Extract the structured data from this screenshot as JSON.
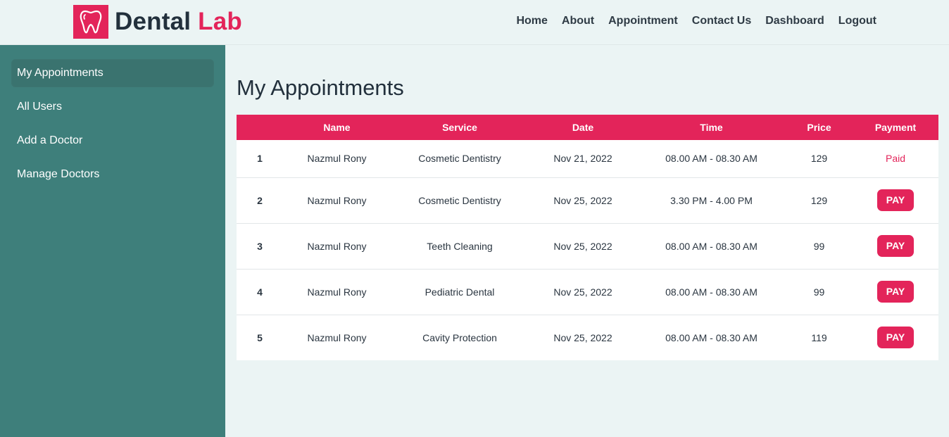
{
  "brand": {
    "word1": "Dental",
    "word2": "Lab",
    "logo_icon": "tooth-icon",
    "accent": "#e3245a"
  },
  "nav": [
    "Home",
    "About",
    "Appointment",
    "Contact Us",
    "Dashboard",
    "Logout"
  ],
  "sidebar": {
    "items": [
      {
        "label": "My Appointments",
        "active": true
      },
      {
        "label": "All Users"
      },
      {
        "label": "Add a Doctor"
      },
      {
        "label": "Manage Doctors"
      }
    ]
  },
  "main": {
    "title": "My Appointments",
    "columns": [
      "",
      "Name",
      "Service",
      "Date",
      "Time",
      "Price",
      "Payment"
    ],
    "rows": [
      {
        "no": "1",
        "name": "Nazmul Rony",
        "service": "Cosmetic Dentistry",
        "date": "Nov 21, 2022",
        "time": "08.00 AM - 08.30 AM",
        "price": "129",
        "payment": "Paid"
      },
      {
        "no": "2",
        "name": "Nazmul Rony",
        "service": "Cosmetic Dentistry",
        "date": "Nov 25, 2022",
        "time": "3.30 PM - 4.00 PM",
        "price": "129",
        "payment": "PAY"
      },
      {
        "no": "3",
        "name": "Nazmul Rony",
        "service": "Teeth Cleaning",
        "date": "Nov 25, 2022",
        "time": "08.00 AM - 08.30 AM",
        "price": "99",
        "payment": "PAY"
      },
      {
        "no": "4",
        "name": "Nazmul Rony",
        "service": "Pediatric Dental",
        "date": "Nov 25, 2022",
        "time": "08.00 AM - 08.30 AM",
        "price": "99",
        "payment": "PAY"
      },
      {
        "no": "5",
        "name": "Nazmul Rony",
        "service": "Cavity Protection",
        "date": "Nov 25, 2022",
        "time": "08.00 AM - 08.30 AM",
        "price": "119",
        "payment": "PAY"
      }
    ]
  },
  "colors": {
    "sidebar_bg": "#3e7f7b",
    "page_bg": "#ebf4f4",
    "header_row": "#e3245a"
  }
}
